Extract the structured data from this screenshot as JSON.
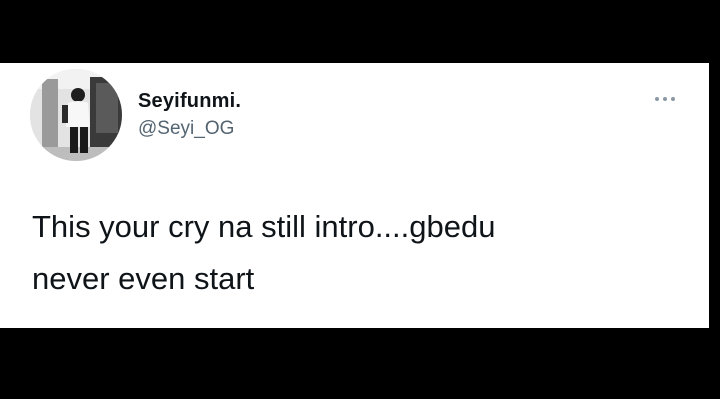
{
  "tweet": {
    "author": {
      "display_name": "Seyifunmi.",
      "handle": "@Seyi_OG",
      "avatar_icon": "profile-photo"
    },
    "text_lines": [
      "This your cry na still intro....gbedu",
      "never even start"
    ],
    "more_icon": "more-horizontal-icon"
  },
  "colors": {
    "background": "#000000",
    "card": "#ffffff",
    "text": "#0f1419",
    "secondary_text": "#536471"
  }
}
